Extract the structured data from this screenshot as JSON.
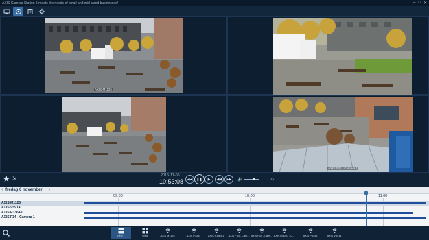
{
  "window": {
    "title": "AXIS Camera Station 5 meets the needs of small and mid-sized businesses!"
  },
  "toolbar": {
    "buttons": [
      "live-view-icon",
      "playback-icon",
      "search-icon",
      "configuration-icon"
    ]
  },
  "cameras": [
    {
      "name": "AXIS M1125"
    },
    {
      "name": ""
    },
    {
      "name": "AXIS P3364"
    },
    {
      "name": "AXIS F34 - Camera 1"
    }
  ],
  "playback": {
    "date": "2015-11-06",
    "time": "10:53:08"
  },
  "timeline": {
    "day_label": "fredag 6 november",
    "ticks": [
      "09:00",
      "10:00",
      "11:00"
    ],
    "rows": [
      {
        "label": "AXIS M1125"
      },
      {
        "label": "AXIS V5914"
      },
      {
        "label": "AXIS P3364-L"
      },
      {
        "label": "AXIS F34 - Camera 1"
      }
    ]
  },
  "bottom_views": [
    {
      "label": "View 1",
      "icon": "grid-view-icon"
    },
    {
      "label": "View",
      "icon": "grid-view-icon"
    },
    {
      "label": "AXIS M1125",
      "icon": "camera-icon"
    },
    {
      "label": "AXIS P3364",
      "icon": "camera-icon"
    },
    {
      "label": "AXIS P3364-L",
      "icon": "camera-icon"
    },
    {
      "label": "AXIS F34 - Cam...",
      "icon": "camera-icon"
    },
    {
      "label": "AXIS F34 - Cam...",
      "icon": "camera-icon"
    },
    {
      "label": "AXIS M3007 - C...",
      "icon": "camera-icon"
    },
    {
      "label": "AXIS P3346",
      "icon": "camera-icon"
    },
    {
      "label": "AXIS V5914",
      "icon": "camera-icon"
    }
  ],
  "colors": {
    "accent": "#3a6ea5",
    "timeline_bar": "#1f4f9a",
    "background": "#0c1d2e"
  }
}
